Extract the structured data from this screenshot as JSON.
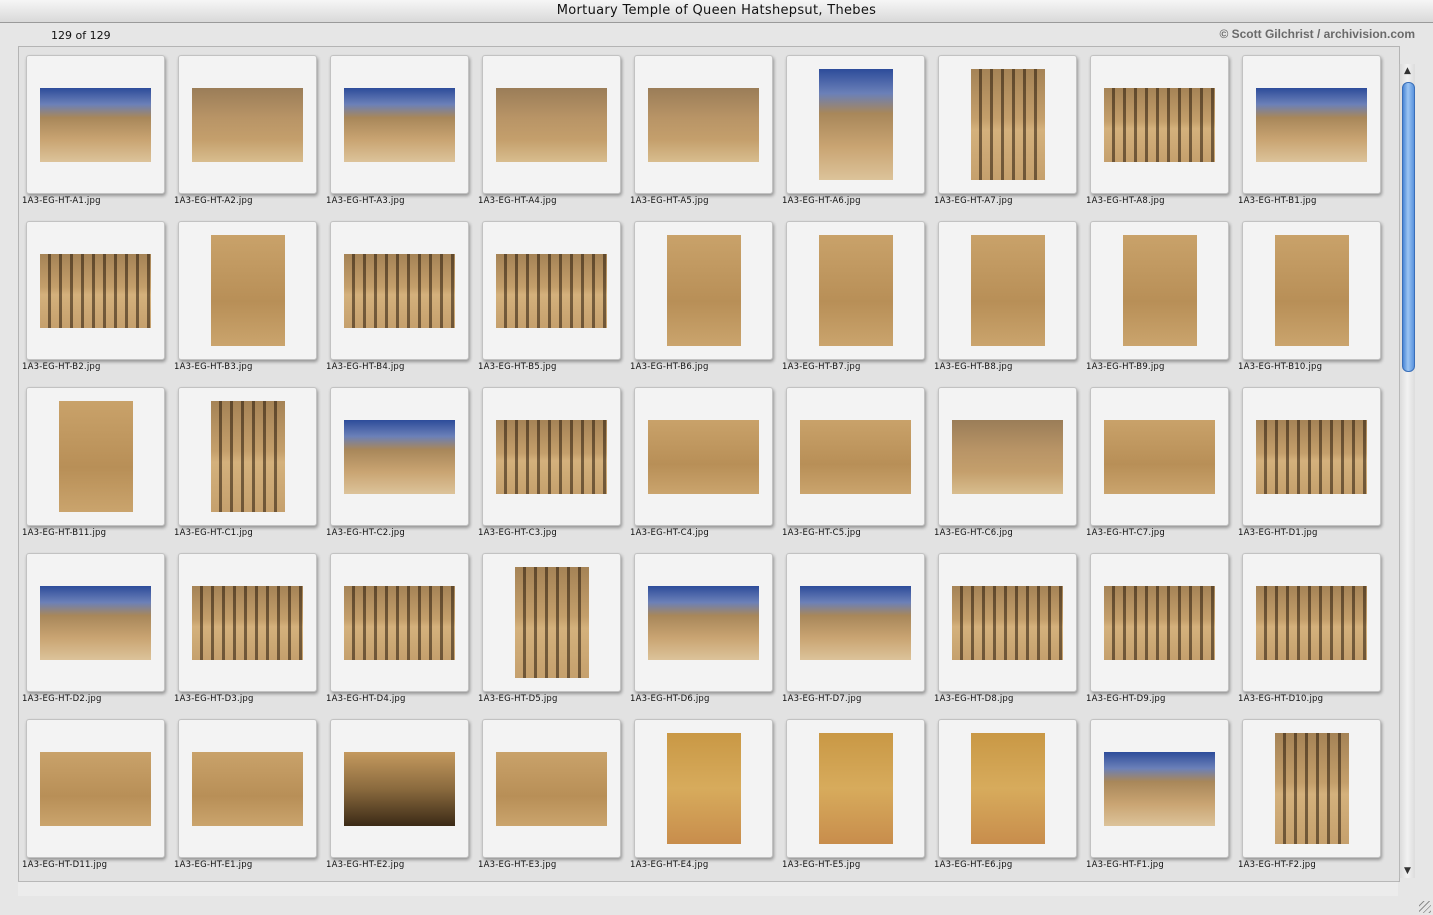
{
  "window": {
    "title": "Mortuary Temple of Queen Hatshepsut, Thebes"
  },
  "header": {
    "count": "129 of 129",
    "credit": "© Scott Gilchrist / archivision.com"
  },
  "thumbnails": [
    {
      "file": "1A3-EG-HT-A1.jpg",
      "orientation": "landscape",
      "style": "sky"
    },
    {
      "file": "1A3-EG-HT-A2.jpg",
      "orientation": "landscape",
      "style": "cliff"
    },
    {
      "file": "1A3-EG-HT-A3.jpg",
      "orientation": "landscape",
      "style": "sky"
    },
    {
      "file": "1A3-EG-HT-A4.jpg",
      "orientation": "landscape",
      "style": "cliff"
    },
    {
      "file": "1A3-EG-HT-A5.jpg",
      "orientation": "landscape",
      "style": "cliff"
    },
    {
      "file": "1A3-EG-HT-A6.jpg",
      "orientation": "portrait",
      "style": "sky"
    },
    {
      "file": "1A3-EG-HT-A7.jpg",
      "orientation": "portrait",
      "style": "temple"
    },
    {
      "file": "1A3-EG-HT-A8.jpg",
      "orientation": "landscape",
      "style": "temple"
    },
    {
      "file": "1A3-EG-HT-B1.jpg",
      "orientation": "landscape",
      "style": "sky"
    },
    {
      "file": "1A3-EG-HT-B2.jpg",
      "orientation": "landscape",
      "style": "temple"
    },
    {
      "file": "1A3-EG-HT-B3.jpg",
      "orientation": "portrait",
      "style": "relief"
    },
    {
      "file": "1A3-EG-HT-B4.jpg",
      "orientation": "landscape",
      "style": "temple"
    },
    {
      "file": "1A3-EG-HT-B5.jpg",
      "orientation": "landscape",
      "style": "temple"
    },
    {
      "file": "1A3-EG-HT-B6.jpg",
      "orientation": "portrait",
      "style": "relief"
    },
    {
      "file": "1A3-EG-HT-B7.jpg",
      "orientation": "portrait",
      "style": "relief"
    },
    {
      "file": "1A3-EG-HT-B8.jpg",
      "orientation": "portrait",
      "style": "relief"
    },
    {
      "file": "1A3-EG-HT-B9.jpg",
      "orientation": "portrait",
      "style": "relief"
    },
    {
      "file": "1A3-EG-HT-B10.jpg",
      "orientation": "portrait",
      "style": "relief"
    },
    {
      "file": "1A3-EG-HT-B11.jpg",
      "orientation": "portrait",
      "style": "relief"
    },
    {
      "file": "1A3-EG-HT-C1.jpg",
      "orientation": "portrait",
      "style": "temple"
    },
    {
      "file": "1A3-EG-HT-C2.jpg",
      "orientation": "landscape",
      "style": "sky"
    },
    {
      "file": "1A3-EG-HT-C3.jpg",
      "orientation": "landscape",
      "style": "temple"
    },
    {
      "file": "1A3-EG-HT-C4.jpg",
      "orientation": "landscape",
      "style": "relief"
    },
    {
      "file": "1A3-EG-HT-C5.jpg",
      "orientation": "landscape",
      "style": "relief"
    },
    {
      "file": "1A3-EG-HT-C6.jpg",
      "orientation": "landscape",
      "style": "cliff"
    },
    {
      "file": "1A3-EG-HT-C7.jpg",
      "orientation": "landscape",
      "style": "relief"
    },
    {
      "file": "1A3-EG-HT-D1.jpg",
      "orientation": "landscape",
      "style": "temple"
    },
    {
      "file": "1A3-EG-HT-D2.jpg",
      "orientation": "landscape",
      "style": "sky"
    },
    {
      "file": "1A3-EG-HT-D3.jpg",
      "orientation": "landscape",
      "style": "temple"
    },
    {
      "file": "1A3-EG-HT-D4.jpg",
      "orientation": "landscape",
      "style": "temple"
    },
    {
      "file": "1A3-EG-HT-D5.jpg",
      "orientation": "portrait",
      "style": "temple"
    },
    {
      "file": "1A3-EG-HT-D6.jpg",
      "orientation": "landscape",
      "style": "sky"
    },
    {
      "file": "1A3-EG-HT-D7.jpg",
      "orientation": "landscape",
      "style": "sky"
    },
    {
      "file": "1A3-EG-HT-D8.jpg",
      "orientation": "landscape",
      "style": "temple"
    },
    {
      "file": "1A3-EG-HT-D9.jpg",
      "orientation": "landscape",
      "style": "temple"
    },
    {
      "file": "1A3-EG-HT-D10.jpg",
      "orientation": "landscape",
      "style": "temple"
    },
    {
      "file": "1A3-EG-HT-D11.jpg",
      "orientation": "landscape",
      "style": "relief"
    },
    {
      "file": "1A3-EG-HT-E1.jpg",
      "orientation": "landscape",
      "style": "relief"
    },
    {
      "file": "1A3-EG-HT-E2.jpg",
      "orientation": "landscape",
      "style": "dark"
    },
    {
      "file": "1A3-EG-HT-E3.jpg",
      "orientation": "landscape",
      "style": "relief"
    },
    {
      "file": "1A3-EG-HT-E4.jpg",
      "orientation": "portrait",
      "style": "painted"
    },
    {
      "file": "1A3-EG-HT-E5.jpg",
      "orientation": "portrait",
      "style": "painted"
    },
    {
      "file": "1A3-EG-HT-E6.jpg",
      "orientation": "portrait",
      "style": "painted"
    },
    {
      "file": "1A3-EG-HT-F1.jpg",
      "orientation": "landscape",
      "style": "sky"
    },
    {
      "file": "1A3-EG-HT-F2.jpg",
      "orientation": "portrait",
      "style": "temple"
    }
  ]
}
